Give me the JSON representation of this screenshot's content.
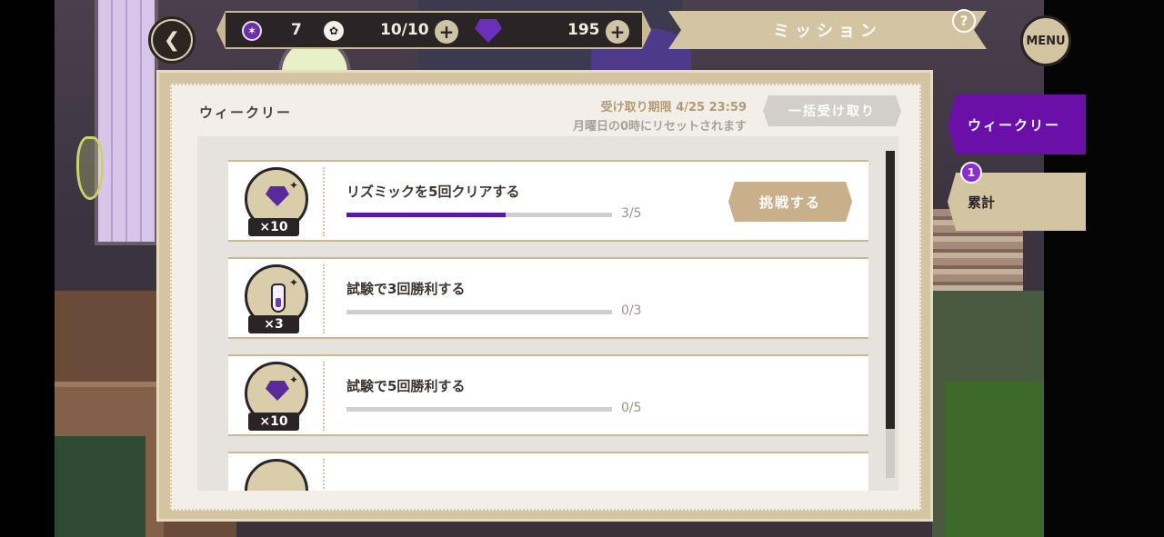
{
  "hud": {
    "back_icon": "chevron-left-icon",
    "orb_count": "7",
    "stamina": "10/10",
    "gem_count": "195",
    "plus_label": "+",
    "plus_label_2": "+",
    "title": "ミッション",
    "help": "?",
    "menu": "MENU"
  },
  "panel": {
    "title": "ウィークリー",
    "deadline": "受け取り期限 4/25 23:59",
    "reset_note": "月曜日の0時にリセットされます",
    "claim_all": "一括受け取り"
  },
  "missions": [
    {
      "title": "リズミックを5回クリアする",
      "progress": "3/5",
      "progress_value": 0.6,
      "reward": "×10",
      "reward_icon": "gem-icon",
      "action": "挑戦する"
    },
    {
      "title": "試験で3回勝利する",
      "progress": "0/3",
      "progress_value": 0,
      "reward": "×3",
      "reward_icon": "potion-icon"
    },
    {
      "title": "試験で5回勝利する",
      "progress": "0/5",
      "progress_value": 0,
      "reward": "×10",
      "reward_icon": "gem-icon"
    }
  ],
  "tabs": {
    "weekly": "ウィークリー",
    "total": "累計",
    "total_badge": "1"
  },
  "colors": {
    "accent_purple": "#6a0fa8",
    "progress_fill": "#5a18a6",
    "gold": "#c9b08a"
  }
}
